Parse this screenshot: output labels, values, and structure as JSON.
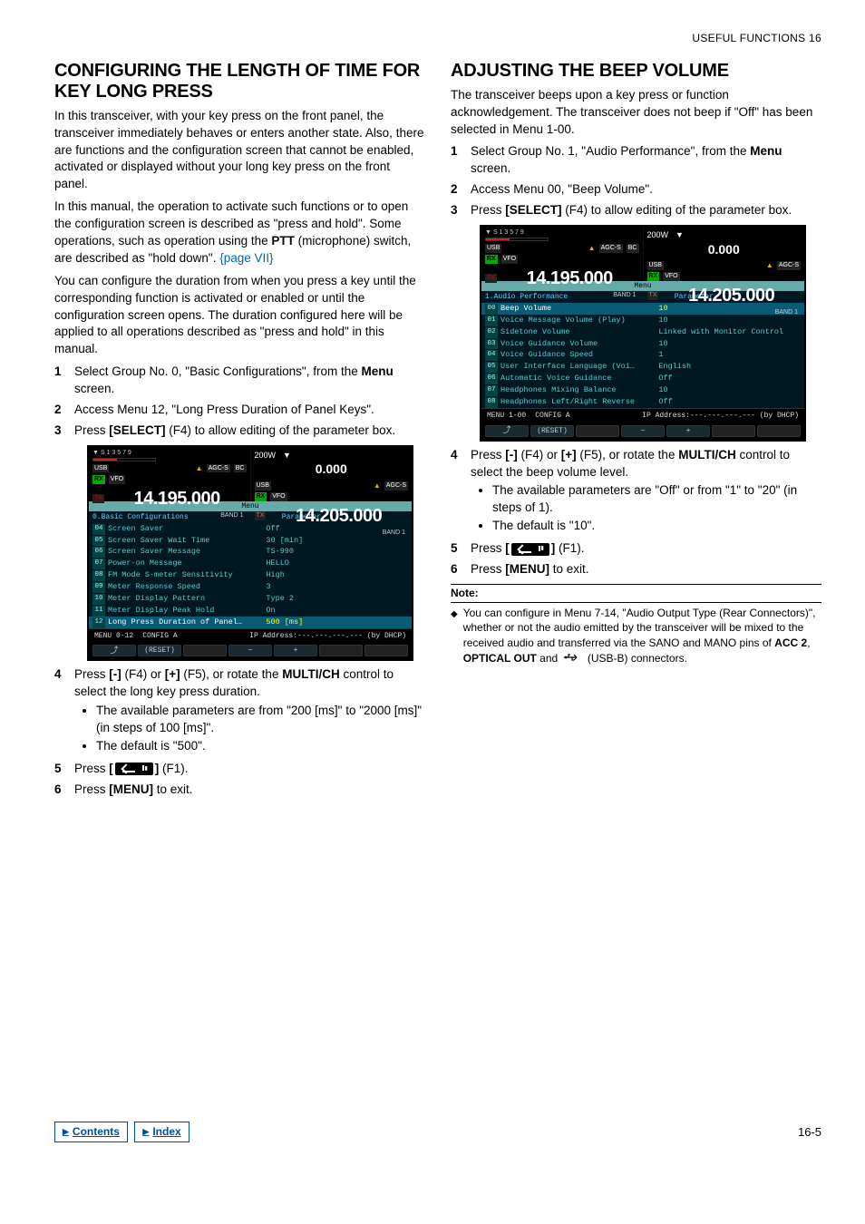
{
  "header": {
    "chapter": "USEFUL FUNCTIONS 16"
  },
  "left": {
    "title": "CONFIGURING THE LENGTH OF TIME FOR KEY LONG PRESS",
    "p1": "In this transceiver, with your key press on the front panel, the transceiver immediately behaves or enters another state. Also, there are functions and the configuration screen that cannot be enabled, activated or displayed without your long key press on the front panel.",
    "p2a": "In this manual, the operation to activate such functions or to open the configuration screen is described as \"press and hold\". Some operations, such as operation using the ",
    "p2_ptt": "PTT",
    "p2b": " (microphone) switch, are described as \"hold down\".  ",
    "p2_link": "{page VII}",
    "p3": "You can configure the duration from when you press a key until the corresponding function is activated or enabled or until the configuration screen opens. The duration configured here will be applied to all operations described as \"press and hold\" in this manual.",
    "s1a": "Select Group No. 0, \"Basic Configurations\", from the ",
    "s1_menu": "Menu",
    "s1b": " screen.",
    "s2": "Access Menu 12, \"Long Press Duration of Panel Keys\".",
    "s3a": "Press ",
    "s3_sel": "[SELECT]",
    "s3b": " (F4) to allow editing of the parameter box.",
    "s4a": "Press ",
    "s4_minus": "[-]",
    "s4b": " (F4) or ",
    "s4_plus": "[+]",
    "s4c": " (F5), or rotate the ",
    "s4_multi": "MULTI/CH",
    "s4d": " control to select the long key press duration.",
    "s4_b1": "The available parameters are from \"200 [ms]\" to \"2000 [ms]\" (in steps of 100 [ms]\".",
    "s4_b2": "The default is \"500\".",
    "s5a": "Press ",
    "s5_b1": "[",
    "s5_b2": "]",
    "s5b": " (F1).",
    "s6a": "Press ",
    "s6_menu": "[MENU]",
    "s6b": " to exit.",
    "scr": {
      "power": "200W",
      "usb": "USB",
      "agc": "AGC-S",
      "rx": "RX",
      "tx": "TX",
      "vfo": "VFO",
      "bc": "BC",
      "freq_l": "14.195.000",
      "sub": "0.000",
      "freq_r": "14.205.000",
      "band": "BAND 1",
      "menu": "Menu",
      "group": "0.Basic Configurations",
      "param": "Parameter",
      "rows": [
        {
          "n": "04",
          "k": "Screen Saver",
          "v": "Off"
        },
        {
          "n": "05",
          "k": "Screen Saver Wait Time",
          "v": "30  [min]"
        },
        {
          "n": "06",
          "k": "Screen Saver Message",
          "v": "TS-990"
        },
        {
          "n": "07",
          "k": "Power-on Message",
          "v": "HELLO"
        },
        {
          "n": "08",
          "k": "FM Mode S-meter Sensitivity",
          "v": "High"
        },
        {
          "n": "09",
          "k": "Meter Response Speed",
          "v": "3"
        },
        {
          "n": "10",
          "k": "Meter Display Pattern",
          "v": "Type 2"
        },
        {
          "n": "11",
          "k": "Meter Display Peak Hold",
          "v": "On"
        },
        {
          "n": "12",
          "k": "Long Press Duration of Panel…",
          "v": "500  [ms]"
        }
      ],
      "bot1": "MENU 0-12",
      "bot2": "CONFIG A",
      "bot3": "IP Address:---.---.---.--- (by DHCP)",
      "reset": "(RESET)",
      "fminus": "−",
      "fplus": "+"
    }
  },
  "right": {
    "title": "ADJUSTING THE BEEP VOLUME",
    "p1": "The transceiver beeps upon a key press or function acknowledgement. The transceiver does not beep if \"Off\" has been selected in Menu 1-00.",
    "s1a": "Select Group No. 1, \"Audio Performance\", from the ",
    "s1_menu": "Menu",
    "s1b": " screen.",
    "s2": "Access Menu 00, \"Beep Volume\".",
    "s3a": "Press ",
    "s3_sel": "[SELECT]",
    "s3b": " (F4) to allow editing of the parameter box.",
    "s4a": "Press ",
    "s4_minus": "[-]",
    "s4b": " (F4) or ",
    "s4_plus": "[+]",
    "s4c": " (F5), or rotate the ",
    "s4_multi": "MULTI/CH",
    "s4d": " control to select the beep volume level.",
    "s4_b1": "The available parameters are \"Off\" or from \"1\" to \"20\" (in steps of 1).",
    "s4_b2": "The default is \"10\".",
    "s5a": "Press ",
    "s5_b1": "[",
    "s5_b2": "]",
    "s5b": " (F1).",
    "s6a": "Press ",
    "s6_menu": "[MENU]",
    "s6b": " to exit.",
    "note_title": "Note:",
    "note_a": "You can configure in Menu 7-14, \"Audio Output Type (Rear Connectors)\", whether or not the audio emitted by the transceiver will be mixed to the received audio and transferred via the SANO and MANO pins of ",
    "note_acc": "ACC 2",
    "note_b": ", ",
    "note_opt": "OPTICAL OUT",
    "note_c": " and ",
    "note_d": " (USB-B) connectors.",
    "scr": {
      "power": "200W",
      "usb": "USB",
      "agc": "AGC-S",
      "rx": "RX",
      "tx": "TX",
      "vfo": "VFO",
      "bc": "BC",
      "freq_l": "14.195.000",
      "sub": "0.000",
      "freq_r": "14.205.000",
      "band": "BAND 1",
      "menu": "Menu",
      "group": "1.Audio Performance",
      "param": "Parameter",
      "rows": [
        {
          "n": "00",
          "k": "Beep Volume",
          "v": "10"
        },
        {
          "n": "01",
          "k": "Voice Message Volume (Play)",
          "v": "10"
        },
        {
          "n": "02",
          "k": "Sidetone Volume",
          "v": "Linked with Monitor Control"
        },
        {
          "n": "03",
          "k": "Voice Guidance Volume",
          "v": "10"
        },
        {
          "n": "04",
          "k": "Voice Guidance Speed",
          "v": "1"
        },
        {
          "n": "05",
          "k": "User Interface Language (Voi…",
          "v": "English"
        },
        {
          "n": "06",
          "k": "Automatic Voice Guidance",
          "v": "Off"
        },
        {
          "n": "07",
          "k": "Headphones Mixing Balance",
          "v": "10"
        },
        {
          "n": "08",
          "k": "Headphones Left/Right Reverse",
          "v": "Off"
        }
      ],
      "bot1": "MENU 1-00",
      "bot2": "CONFIG A",
      "bot3": "IP Address:---.---.---.--- (by DHCP)",
      "reset": "(RESET)",
      "fminus": "−",
      "fplus": "+"
    }
  },
  "footer": {
    "contents": "Contents",
    "index": "Index",
    "page": "16-5"
  }
}
